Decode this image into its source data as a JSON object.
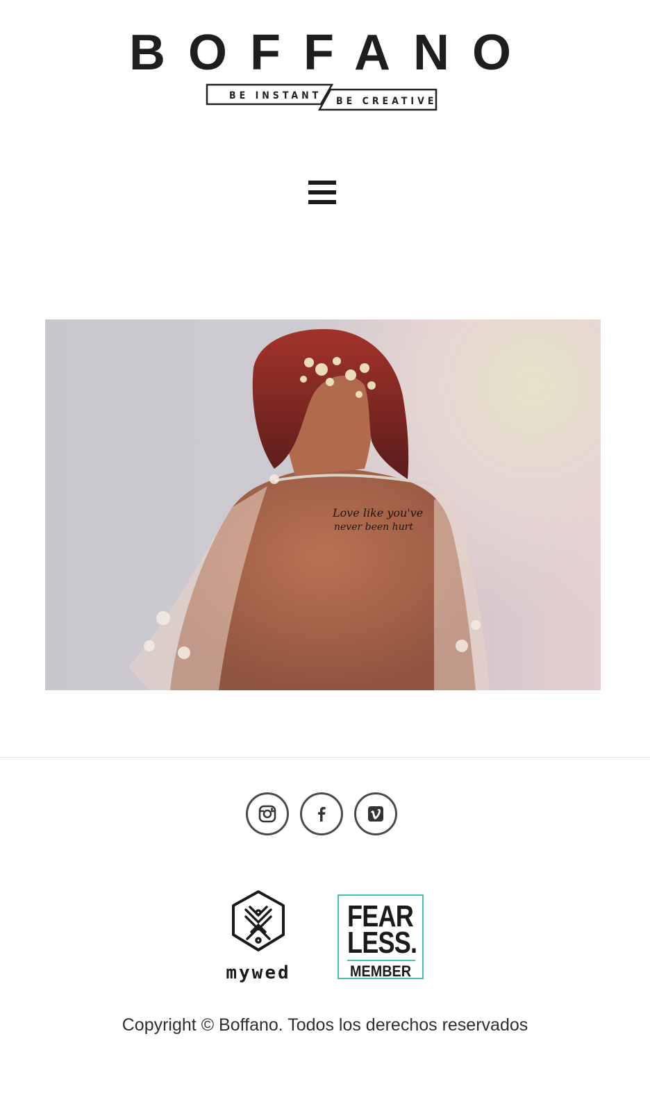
{
  "brand": {
    "name": "BOFFANO",
    "tagline_left": "BE INSTANT",
    "tagline_right": "BE CREATIVE"
  },
  "nav": {
    "menu_icon": "hamburger-menu-icon"
  },
  "hero": {
    "tattoo_line1": "Love like you've",
    "tattoo_line2": "never been hurt"
  },
  "social": [
    {
      "icon": "instagram-icon",
      "name": "Instagram"
    },
    {
      "icon": "facebook-icon",
      "name": "Facebook"
    },
    {
      "icon": "vimeo-icon",
      "name": "Vimeo"
    }
  ],
  "badges": {
    "mywed": "mywed",
    "fearless_line1": "FEAR",
    "fearless_line2": "LESS.",
    "fearless_member": "MEMBER"
  },
  "footer": {
    "copyright": "Copyright © Boffano. Todos los derechos reservados"
  },
  "colors": {
    "fearless_accent": "#4bbfae",
    "text_dark": "#1b1b1b",
    "divider": "#e3e3e3"
  }
}
